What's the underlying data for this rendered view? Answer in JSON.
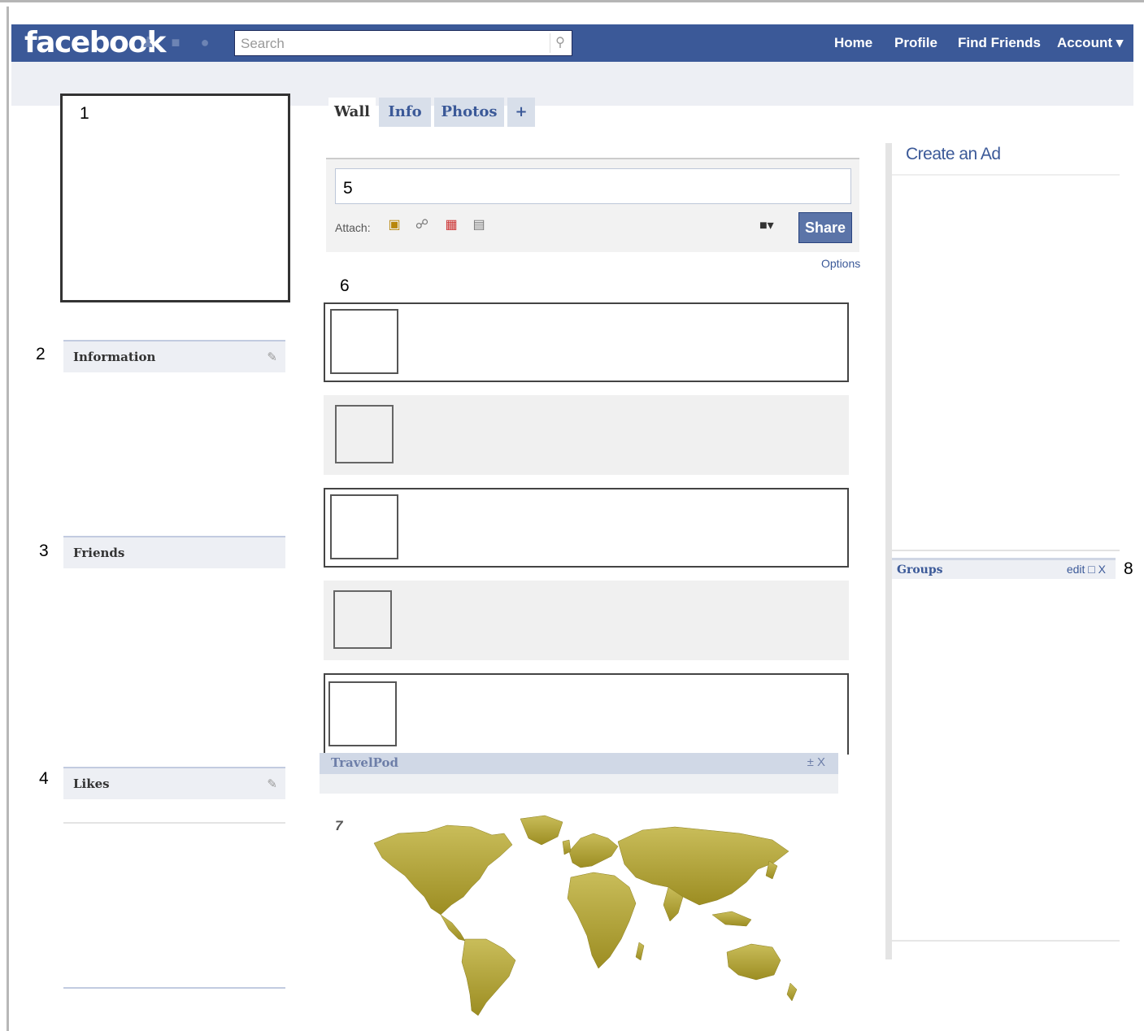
{
  "header": {
    "logo": "facebook",
    "search_placeholder": "Search",
    "nav": [
      "Home",
      "Profile",
      "Find Friends",
      "Account ▾"
    ]
  },
  "tabs": [
    "Wall",
    "Info",
    "Photos",
    "+"
  ],
  "publisher": {
    "attach_label": "Attach:",
    "share_label": "Share",
    "options_label": "Options",
    "privacy_icon": "lock-icon"
  },
  "left_boxes": {
    "information": "Information",
    "friends": "Friends",
    "likes": "Likes"
  },
  "travelpod": {
    "title": "TravelPod",
    "controls": "± X"
  },
  "sidebar": {
    "create_ad": "Create an Ad",
    "groups_title": "Groups",
    "groups_controls": "edit □ X"
  },
  "markers": {
    "m1": "1",
    "m2": "2",
    "m3": "3",
    "m4": "4",
    "m5": "5",
    "m6": "6",
    "m7": "7",
    "m8": "8"
  },
  "colors": {
    "brand": "#3b5998",
    "subbar": "#edeff4",
    "map_land": "#b4a63c"
  }
}
